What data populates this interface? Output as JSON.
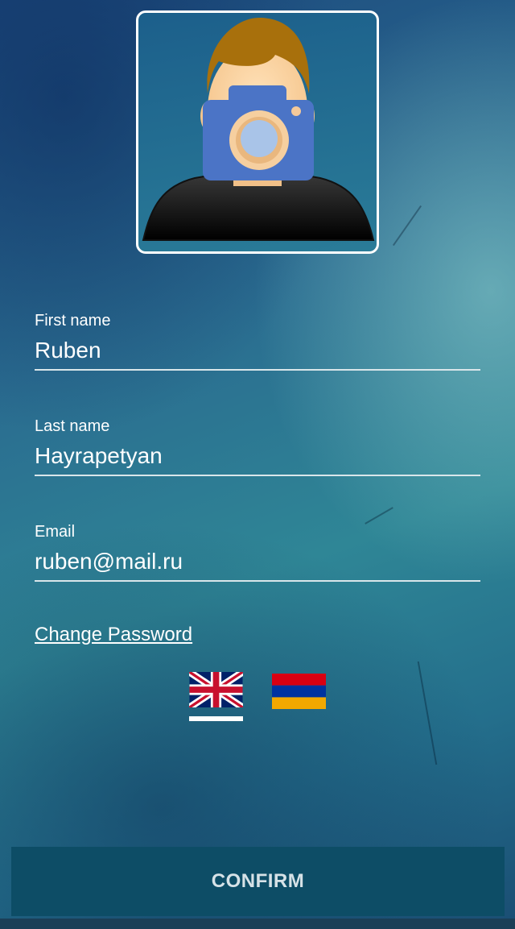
{
  "profile": {
    "avatar_icon": "user-photo-camera-icon"
  },
  "form": {
    "first_name": {
      "label": "First name",
      "value": "Ruben"
    },
    "last_name": {
      "label": "Last name",
      "value": "Hayrapetyan"
    },
    "email": {
      "label": "Email",
      "value": "ruben@mail.ru"
    }
  },
  "links": {
    "change_password": "Change Password"
  },
  "languages": {
    "options": [
      {
        "name": "uk-flag-icon",
        "selected": true
      },
      {
        "name": "armenia-flag-icon",
        "selected": false
      }
    ]
  },
  "actions": {
    "confirm_label": "CONFIRM"
  },
  "colors": {
    "accent_button": "#0d4d66",
    "text": "#ffffff"
  }
}
